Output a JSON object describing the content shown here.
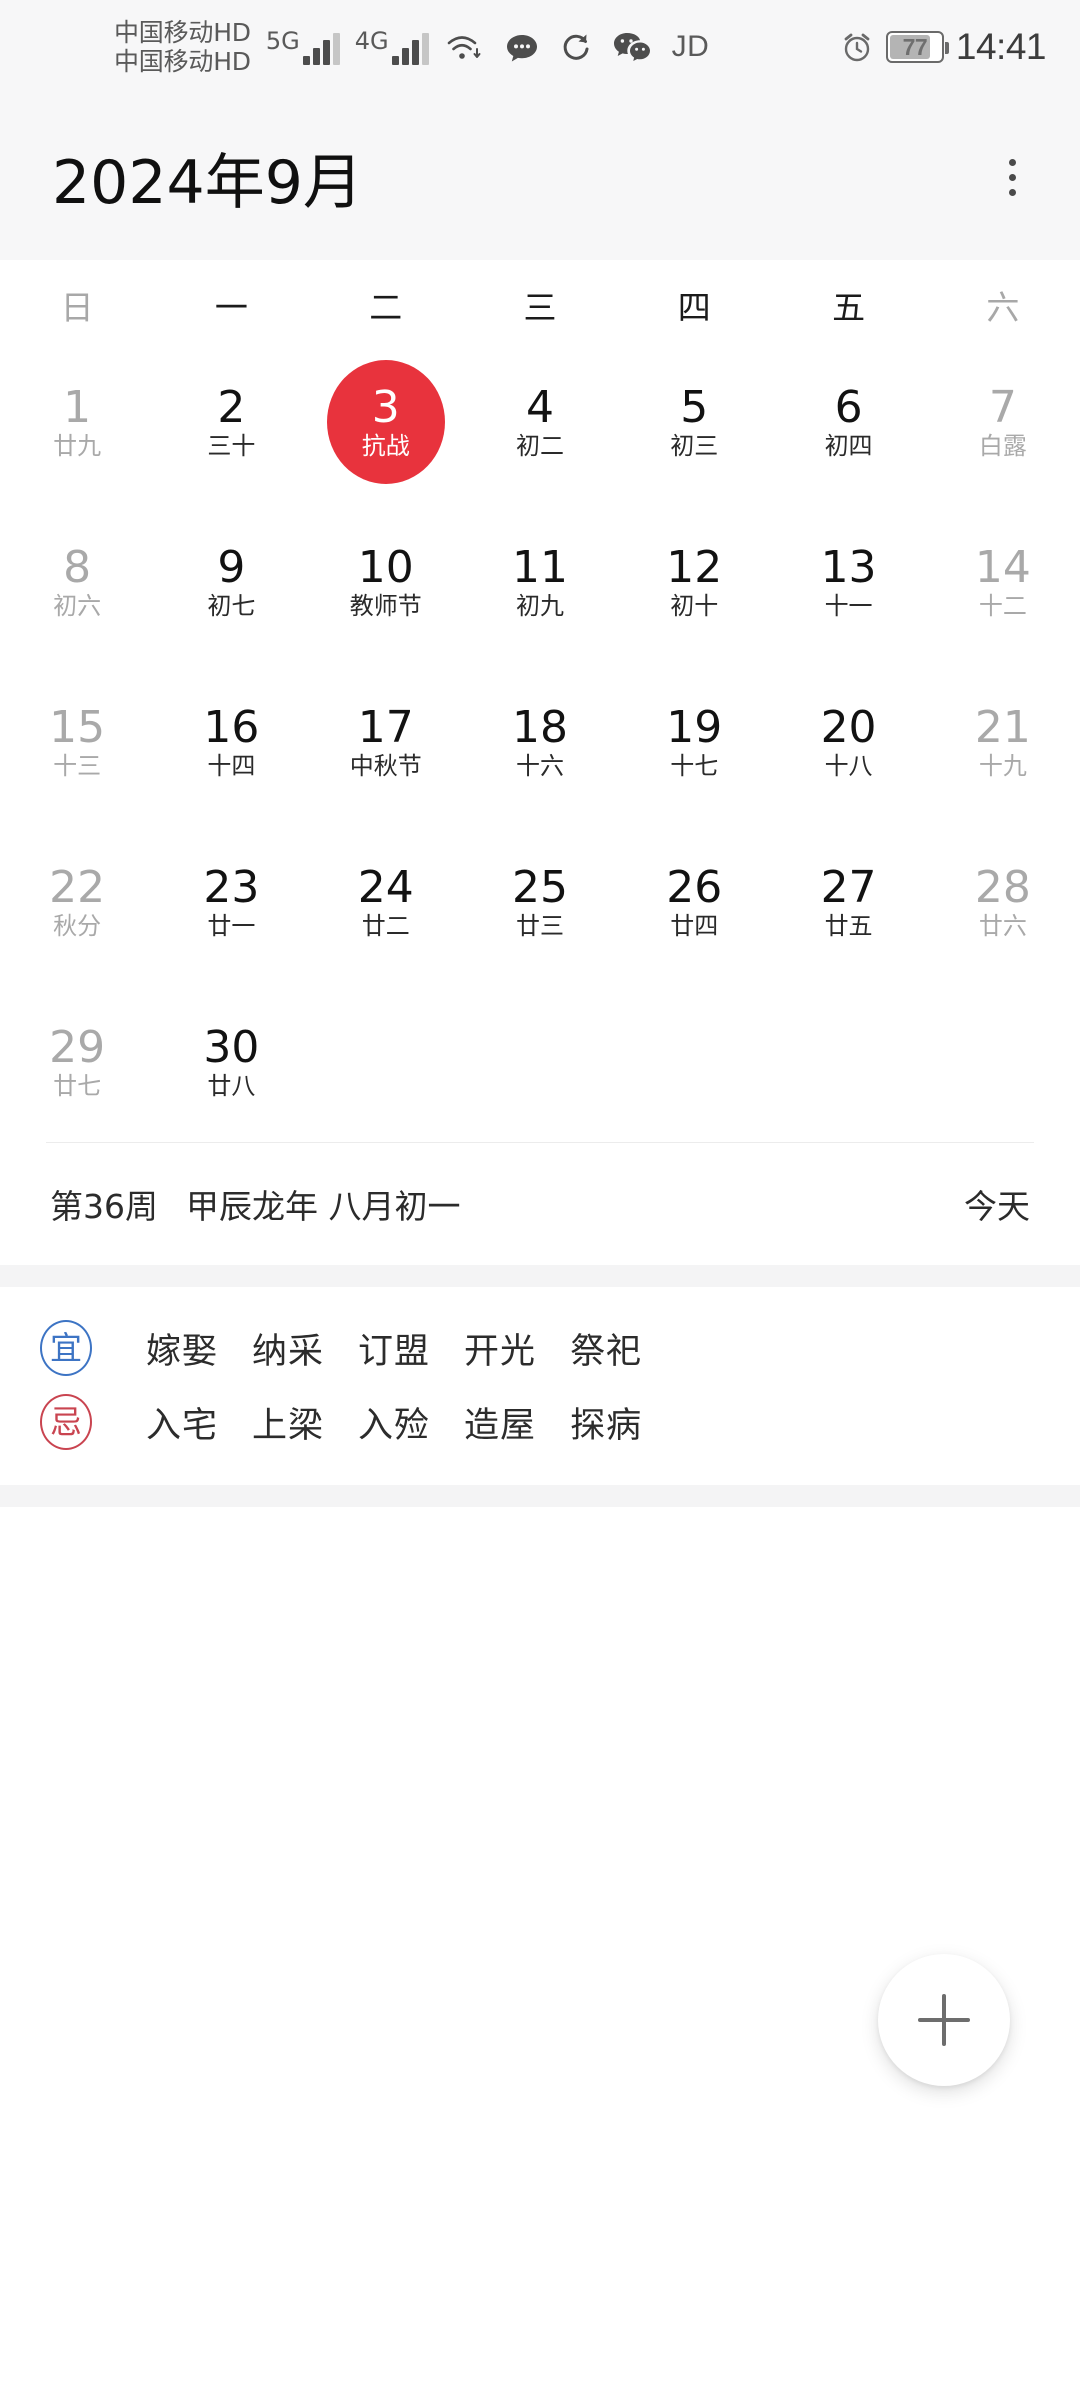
{
  "status_bar": {
    "carrier_line_1": "中国移动HD",
    "carrier_line_2": "中国移动HD",
    "network_1": "5G",
    "network_2": "4G",
    "wifi_icon": "wifi-icon",
    "sms_icon": "sms-icon",
    "sync_icon": "sync-icon",
    "wechat_icon": "wechat-icon",
    "jd_label": "JD",
    "alarm_icon": "alarm-clock-icon",
    "battery_percent": "77",
    "time": "14:41"
  },
  "title_bar": {
    "month_title": "2024年9月",
    "overflow_icon": "more-vertical-icon"
  },
  "calendar": {
    "weekdays": [
      {
        "label": "日",
        "dim": true
      },
      {
        "label": "一",
        "dim": false
      },
      {
        "label": "二",
        "dim": false
      },
      {
        "label": "三",
        "dim": false
      },
      {
        "label": "四",
        "dim": false
      },
      {
        "label": "五",
        "dim": false
      },
      {
        "label": "六",
        "dim": true
      }
    ],
    "weeks": [
      [
        {
          "num": "1",
          "sub": "廿九",
          "weekend": true,
          "today": false
        },
        {
          "num": "2",
          "sub": "三十",
          "weekend": false,
          "today": false
        },
        {
          "num": "3",
          "sub": "抗战",
          "weekend": false,
          "today": true
        },
        {
          "num": "4",
          "sub": "初二",
          "weekend": false,
          "today": false
        },
        {
          "num": "5",
          "sub": "初三",
          "weekend": false,
          "today": false
        },
        {
          "num": "6",
          "sub": "初四",
          "weekend": false,
          "today": false
        },
        {
          "num": "7",
          "sub": "白露",
          "weekend": true,
          "today": false
        }
      ],
      [
        {
          "num": "8",
          "sub": "初六",
          "weekend": true,
          "today": false
        },
        {
          "num": "9",
          "sub": "初七",
          "weekend": false,
          "today": false
        },
        {
          "num": "10",
          "sub": "教师节",
          "weekend": false,
          "today": false
        },
        {
          "num": "11",
          "sub": "初九",
          "weekend": false,
          "today": false
        },
        {
          "num": "12",
          "sub": "初十",
          "weekend": false,
          "today": false
        },
        {
          "num": "13",
          "sub": "十一",
          "weekend": false,
          "today": false
        },
        {
          "num": "14",
          "sub": "十二",
          "weekend": true,
          "today": false
        }
      ],
      [
        {
          "num": "15",
          "sub": "十三",
          "weekend": true,
          "today": false
        },
        {
          "num": "16",
          "sub": "十四",
          "weekend": false,
          "today": false
        },
        {
          "num": "17",
          "sub": "中秋节",
          "weekend": false,
          "today": false
        },
        {
          "num": "18",
          "sub": "十六",
          "weekend": false,
          "today": false
        },
        {
          "num": "19",
          "sub": "十七",
          "weekend": false,
          "today": false
        },
        {
          "num": "20",
          "sub": "十八",
          "weekend": false,
          "today": false
        },
        {
          "num": "21",
          "sub": "十九",
          "weekend": true,
          "today": false
        }
      ],
      [
        {
          "num": "22",
          "sub": "秋分",
          "weekend": true,
          "today": false
        },
        {
          "num": "23",
          "sub": "廿一",
          "weekend": false,
          "today": false
        },
        {
          "num": "24",
          "sub": "廿二",
          "weekend": false,
          "today": false
        },
        {
          "num": "25",
          "sub": "廿三",
          "weekend": false,
          "today": false
        },
        {
          "num": "26",
          "sub": "廿四",
          "weekend": false,
          "today": false
        },
        {
          "num": "27",
          "sub": "廿五",
          "weekend": false,
          "today": false
        },
        {
          "num": "28",
          "sub": "廿六",
          "weekend": true,
          "today": false
        }
      ],
      [
        {
          "num": "29",
          "sub": "廿七",
          "weekend": true,
          "today": false
        },
        {
          "num": "30",
          "sub": "廿八",
          "weekend": false,
          "today": false
        },
        {
          "num": "",
          "sub": "",
          "weekend": false,
          "today": false,
          "empty": true
        },
        {
          "num": "",
          "sub": "",
          "weekend": false,
          "today": false,
          "empty": true
        },
        {
          "num": "",
          "sub": "",
          "weekend": false,
          "today": false,
          "empty": true
        },
        {
          "num": "",
          "sub": "",
          "weekend": false,
          "today": false,
          "empty": true
        },
        {
          "num": "",
          "sub": "",
          "weekend": false,
          "today": false,
          "empty": true
        }
      ]
    ]
  },
  "week_info": {
    "week_number": "第36周",
    "lunar_year_date": "甲辰龙年 八月初一",
    "today_button": "今天"
  },
  "almanac": {
    "yi_seal": "宜",
    "yi_items": [
      "嫁娶",
      "纳采",
      "订盟",
      "开光",
      "祭祀"
    ],
    "ji_seal": "忌",
    "ji_items": [
      "入宅",
      "上梁",
      "入殓",
      "造屋",
      "探病"
    ]
  },
  "fab": {
    "icon": "plus-icon"
  },
  "colors": {
    "today_red": "#e8333d",
    "yi_blue": "#3d74c4",
    "ji_red": "#c94450",
    "header_bg": "#f7f7f8"
  }
}
